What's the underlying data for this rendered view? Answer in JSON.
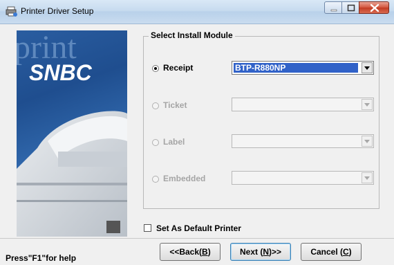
{
  "window": {
    "title": "Printer Driver Setup"
  },
  "banner": {
    "brand": "SNBC",
    "watermark": "print"
  },
  "group": {
    "title": "Select Install Module"
  },
  "modules": [
    {
      "label": "Receipt",
      "selected": true,
      "enabled": true,
      "value": "BTP-R880NP"
    },
    {
      "label": "Ticket",
      "selected": false,
      "enabled": false,
      "value": ""
    },
    {
      "label": "Label",
      "selected": false,
      "enabled": false,
      "value": ""
    },
    {
      "label": "Embedded",
      "selected": false,
      "enabled": false,
      "value": ""
    }
  ],
  "options": {
    "default_printer_label": "Set As Default Printer",
    "default_printer_checked": false
  },
  "buttons": {
    "back_label": "<<Back",
    "back_key": "B",
    "next_label": "Next ",
    "next_key": "N",
    "next_suffix": ">>",
    "cancel_label": "Cancel ",
    "cancel_key": "C"
  },
  "status": {
    "help_text": "Press\"F1\"for help"
  },
  "icons": {
    "title_icon": "printer-setup-icon",
    "minimize": "minimize-icon",
    "maximize": "maximize-icon",
    "close": "close-icon",
    "dropdown": "chevron-down-icon"
  }
}
